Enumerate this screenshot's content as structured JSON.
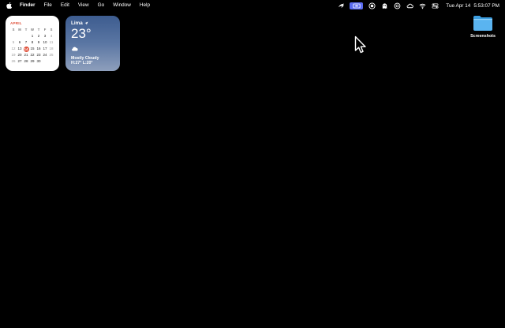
{
  "menubar": {
    "apple_icon": "apple-logo-icon",
    "items": [
      {
        "label": "Finder",
        "bold": true
      },
      {
        "label": "File"
      },
      {
        "label": "Edit"
      },
      {
        "label": "View"
      },
      {
        "label": "Go"
      },
      {
        "label": "Window"
      },
      {
        "label": "Help"
      }
    ],
    "status_icons": [
      "pointer-icon",
      "screen-share-icon",
      "record-icon",
      "ghost-icon",
      "chatgpt-icon",
      "cloud-sync-icon",
      "wifi-icon",
      "control-center-icon"
    ],
    "clock": {
      "date": "Tue Apr 14",
      "time": "5:53:07 PM"
    }
  },
  "calendar_widget": {
    "month": "APRIL",
    "weekdays": [
      "S",
      "M",
      "T",
      "W",
      "T",
      "F",
      "S"
    ],
    "weeks": [
      [
        "",
        "",
        "",
        "1",
        "2",
        "3",
        "4"
      ],
      [
        "5",
        "6",
        "7",
        "8",
        "9",
        "10",
        "11"
      ],
      [
        "12",
        "13",
        "14",
        "15",
        "16",
        "17",
        "18"
      ],
      [
        "19",
        "20",
        "21",
        "22",
        "23",
        "24",
        "25"
      ],
      [
        "26",
        "27",
        "28",
        "29",
        "30",
        "",
        ""
      ]
    ],
    "today": "14",
    "accent_color": "#e0533d"
  },
  "weather_widget": {
    "city": "Lima",
    "temperature": "23°",
    "condition_icon": "cloud-icon",
    "condition": "Mostly Cloudy",
    "high_low": "H:27° L:20°"
  },
  "desktop": {
    "folder": {
      "label": "Screenshots",
      "color": "#5ab4f0"
    }
  }
}
